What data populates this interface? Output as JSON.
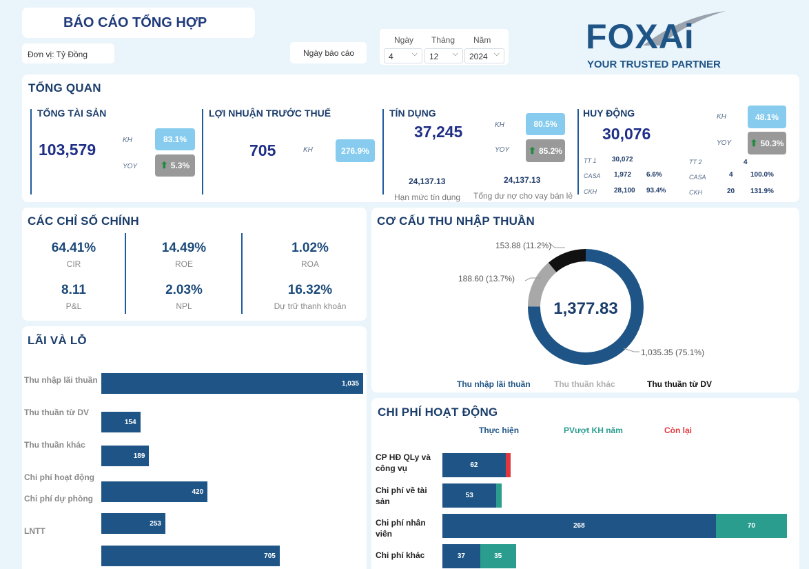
{
  "header": {
    "title": "BÁO CÁO TỔNG HỢP",
    "unit": "Đơn vị: Tỷ Đồng",
    "report_date_label": "Ngày báo cáo",
    "day_label": "Ngày",
    "month_label": "Tháng",
    "year_label": "Năm",
    "day_value": "4",
    "month_value": "12",
    "year_value": "2024",
    "logo_text": "FOXAi",
    "logo_tagline": "YOUR TRUSTED PARTNER"
  },
  "overview": {
    "title": "TỔNG QUAN",
    "total_assets": {
      "label": "TỔNG TÀI SẢN",
      "value": "103,579",
      "kh_label": "KH",
      "kh": "83.1%",
      "yoy_label": "YOY",
      "yoy": "5.3%"
    },
    "pretax_profit": {
      "label": "LỢI NHUẬN TRƯỚC THUẾ",
      "value": "705",
      "kh_label": "KH",
      "kh": "276.9%"
    },
    "credit": {
      "label": "TÍN DỤNG",
      "value": "37,245",
      "kh_label": "KH",
      "kh": "80.5%",
      "yoy_label": "YOY",
      "yoy": "85.2%",
      "limit_value": "24,137.13",
      "limit_label": "Hạn mức tín dụng",
      "retail_value": "24,137.13",
      "retail_label": "Tổng dư nợ cho vay bán lẻ"
    },
    "mobilization": {
      "label": "HUY ĐỘNG",
      "value": "30,076",
      "kh_label": "KH",
      "kh": "48.1%",
      "yoy_label": "YOY",
      "yoy": "50.3%",
      "tt1": {
        "label": "TT 1",
        "value": "30,072",
        "casa_label": "CASA",
        "casa": "1,972",
        "casa_pct": "6.6%",
        "ckh_label": "CKH",
        "ckh": "28,100",
        "ckh_pct": "93.4%"
      },
      "tt2": {
        "label": "TT 2",
        "value": "4",
        "casa_label": "CASA",
        "casa": "4",
        "casa_pct": "100.0%",
        "ckh_label": "CKH",
        "ckh": "20",
        "ckh_pct": "131.9%"
      }
    }
  },
  "ratios": {
    "title": "CÁC CHỈ SỐ CHÍNH",
    "items": [
      {
        "value": "64.41%",
        "label": "CIR"
      },
      {
        "value": "14.49%",
        "label": "ROE"
      },
      {
        "value": "1.02%",
        "label": "ROA"
      },
      {
        "value": "8.11",
        "label": "P&L"
      },
      {
        "value": "2.03%",
        "label": "NPL"
      },
      {
        "value": "16.32%",
        "label": "Dự trữ thanh khoản"
      }
    ]
  },
  "pnl": {
    "title": "LÃI VÀ LỖ",
    "labels": [
      "Thu nhập lãi thuần",
      "Thu thuần từ DV",
      "Thu thuần khác",
      "Chi phí hoạt động",
      "Chi phí dự phòng",
      "LNTT"
    ],
    "bar_labels": [
      "1,035",
      "154",
      "189",
      "420",
      "253",
      "705"
    ],
    "bar_values": [
      1035,
      154,
      189,
      420,
      253,
      705
    ]
  },
  "chart_data": [
    {
      "type": "pie",
      "title": "CƠ CẤU THU NHẬP THUẦN",
      "center_label": "1,377.83",
      "series": [
        {
          "name": "Thu nhập lãi thuần",
          "value": 1035.35,
          "label": "1,035.35 (75.1%)",
          "color": "#1f5586"
        },
        {
          "name": "Thu thuần khác",
          "value": 188.6,
          "label": "188.60 (13.7%)",
          "color": "#a8a8a8"
        },
        {
          "name": "Thu thuần từ DV",
          "value": 153.88,
          "label": "153.88 (11.2%)",
          "color": "#111111"
        }
      ]
    },
    {
      "type": "bar",
      "title": "CHI PHÍ HOẠT ĐỘNG",
      "categories": [
        "CP HĐ QLy và công vụ",
        "Chi phí về tài sản",
        "Chi phí nhân viên",
        "Chi phí khác"
      ],
      "series": [
        {
          "name": "Thực hiện",
          "values": [
            62,
            53,
            268,
            37
          ],
          "color": "#1f5586"
        },
        {
          "name": "PVượt KH năm",
          "values": [
            0,
            5,
            70,
            35
          ],
          "color": "#2a9d8f"
        },
        {
          "name": "Còn lại",
          "values": [
            5,
            0,
            0,
            0
          ],
          "color": "#e0383e"
        }
      ],
      "segment_labels": [
        [
          "62",
          "",
          ""
        ],
        [
          "53",
          "",
          ""
        ],
        [
          "268",
          "70",
          ""
        ],
        [
          "37",
          "35",
          ""
        ]
      ]
    }
  ]
}
